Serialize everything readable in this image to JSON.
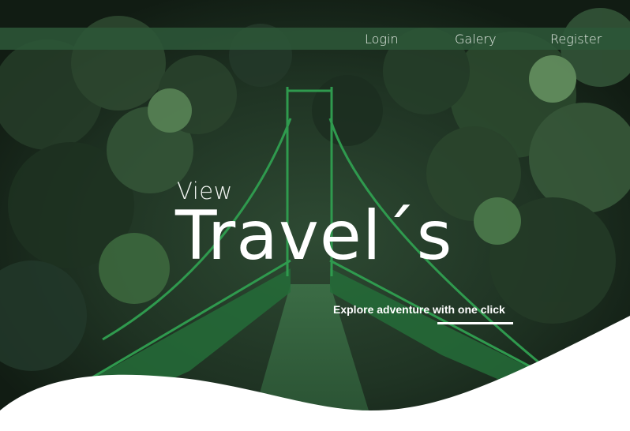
{
  "nav": {
    "items": [
      {
        "label": "Login"
      },
      {
        "label": "Galery"
      },
      {
        "label": "Register"
      }
    ]
  },
  "hero": {
    "eyebrow": "View",
    "title": "Travel´s",
    "tagline": "Explore adventure with one click"
  },
  "colors": {
    "navbar": "#2c5638",
    "bridge": "#2f8a48",
    "text": "#ffffff",
    "wave": "#ffffff"
  }
}
